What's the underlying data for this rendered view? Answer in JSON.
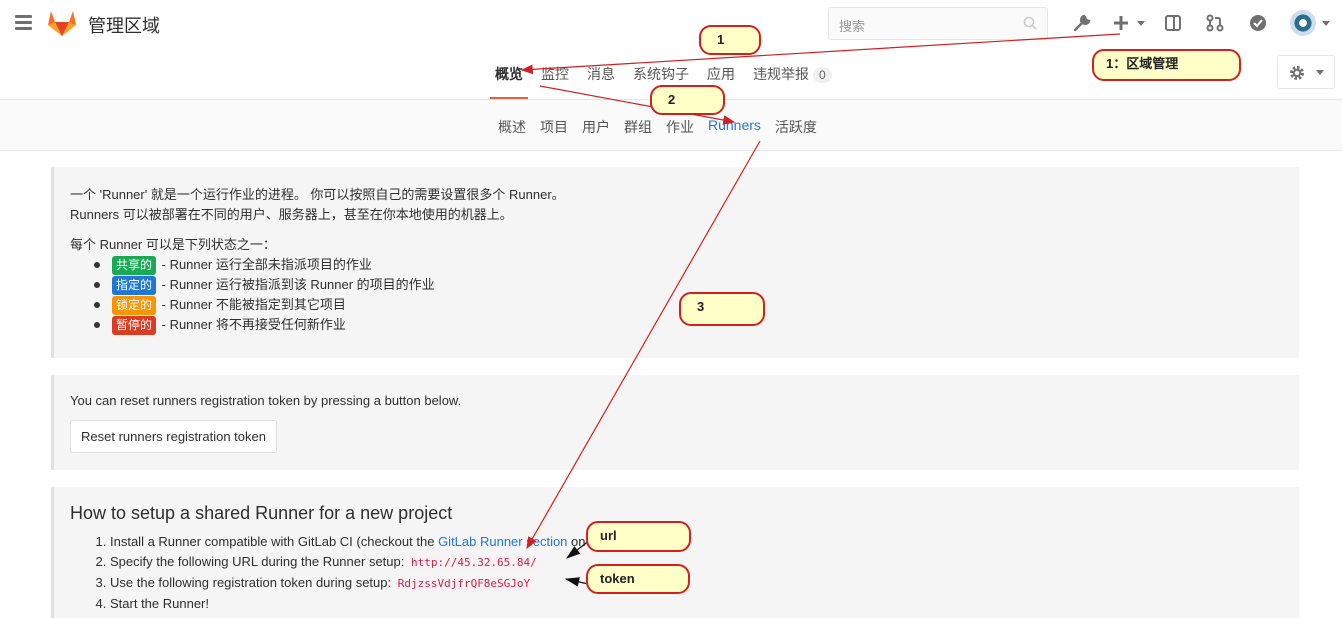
{
  "header": {
    "title": "管理区域",
    "search_placeholder": "搜索"
  },
  "nav_primary": {
    "tabs": [
      "概览",
      "监控",
      "消息",
      "系统钩子",
      "应用",
      "违规举报"
    ],
    "abuse_count": "0"
  },
  "nav_secondary": {
    "tabs": [
      "概述",
      "项目",
      "用户",
      "群组",
      "作业",
      "Runners",
      "活跃度"
    ]
  },
  "intro": {
    "line1": "一个 'Runner' 就是一个运行作业的进程。 你可以按照自己的需要设置很多个 Runner。",
    "line2": "Runners 可以被部署在不同的用户、服务器上，甚至在你本地使用的机器上。",
    "states_heading": "每个 Runner 可以是下列状态之一：",
    "states": [
      {
        "label": "共享的",
        "text": " - Runner 运行全部未指派项目的作业",
        "color": "#1aaa55"
      },
      {
        "label": "指定的",
        "text": " - Runner 运行被指派到该 Runner 的项目的作业",
        "color": "#1f78d1"
      },
      {
        "label": "锁定的",
        "text": " - Runner 不能被指定到其它项目",
        "color": "#fc9403"
      },
      {
        "label": "暂停的",
        "text": " - Runner 将不再接受任何新作业",
        "color": "#db3b21"
      }
    ]
  },
  "reset": {
    "text": "You can reset runners registration token by pressing a button below.",
    "button": "Reset runners registration token"
  },
  "setup": {
    "heading": "How to setup a shared Runner for a new project",
    "step1_pre": "Install a Runner compatible with GitLab CI (checkout the ",
    "step1_link": "GitLab Runner section",
    "step1_post": " on how to install it).",
    "step2_pre": "Specify the following URL during the Runner setup: ",
    "step2_code": "http://45.32.65.84/",
    "step3_pre": "Use the following registration token during setup: ",
    "step3_code": "RdjzssVdjfrQF8eSGJoY",
    "step4": "Start the Runner!"
  },
  "annotations": {
    "c1": "1",
    "c1b": "1：区域管理",
    "c2": "2",
    "c3": "3",
    "url": "url",
    "token": "token"
  }
}
